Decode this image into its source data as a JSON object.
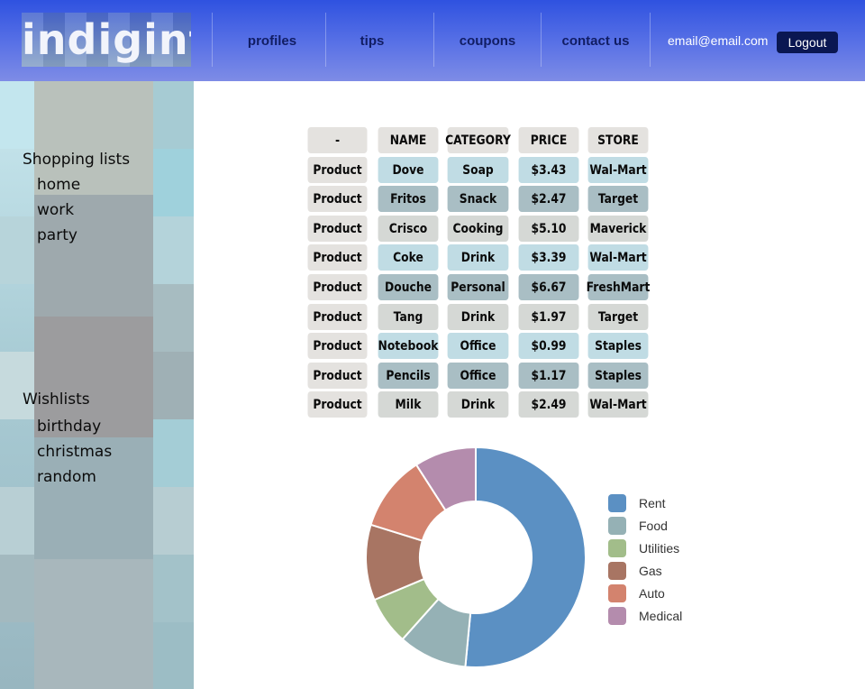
{
  "header": {
    "logo_text": "indigint",
    "nav": [
      {
        "label": "profiles"
      },
      {
        "label": "tips"
      },
      {
        "label": "coupons"
      },
      {
        "label": "contact us"
      }
    ],
    "email": "email@email.com",
    "logout_label": "Logout"
  },
  "sidebar": {
    "shopping_title": "Shopping lists",
    "shopping_items": [
      "home",
      "work",
      "party"
    ],
    "wishlist_title": "Wishlists",
    "wishlist_items": [
      "birthday",
      "christmas",
      "random"
    ]
  },
  "table": {
    "headers": [
      "-",
      "NAME",
      "CATEGORY",
      "PRICE",
      "STORE"
    ],
    "rows": [
      [
        "Product",
        "Dove",
        "Soap",
        "$3.43",
        "Wal-Mart"
      ],
      [
        "Product",
        "Fritos",
        "Snack",
        "$2.47",
        "Target"
      ],
      [
        "Product",
        "Crisco",
        "Cooking",
        "$5.10",
        "Maverick"
      ],
      [
        "Product",
        "Coke",
        "Drink",
        "$3.39",
        "Wal-Mart"
      ],
      [
        "Product",
        "Douche",
        "Personal",
        "$6.67",
        "FreshMart"
      ],
      [
        "Product",
        "Tang",
        "Drink",
        "$1.97",
        "Target"
      ],
      [
        "Product",
        "Notebook",
        "Office",
        "$0.99",
        "Staples"
      ],
      [
        "Product",
        "Pencils",
        "Office",
        "$1.17",
        "Staples"
      ],
      [
        "Product",
        "Milk",
        "Drink",
        "$2.49",
        "Wal-Mart"
      ]
    ],
    "row_colors": [
      "#c0dce4",
      "#a9bec4",
      "#d5d8d5",
      "#c0dce4",
      "#a9bec4",
      "#d5d8d5",
      "#c0dce4",
      "#a9bec4",
      "#d5d8d5"
    ]
  },
  "chart_data": {
    "type": "pie",
    "style": "donut",
    "title": "",
    "categories": [
      "Rent",
      "Food",
      "Utilities",
      "Gas",
      "Auto",
      "Medical"
    ],
    "values": [
      51,
      10,
      7,
      11,
      11,
      9
    ],
    "colors": [
      "#5b90c3",
      "#95b1b5",
      "#a2bd8a",
      "#a87563",
      "#d3836e",
      "#b48cad"
    ],
    "legend": "right"
  },
  "colors": {
    "header_accent": "#2f52e0",
    "logout_button": "#0a1752",
    "nav_text": "#111d63"
  }
}
